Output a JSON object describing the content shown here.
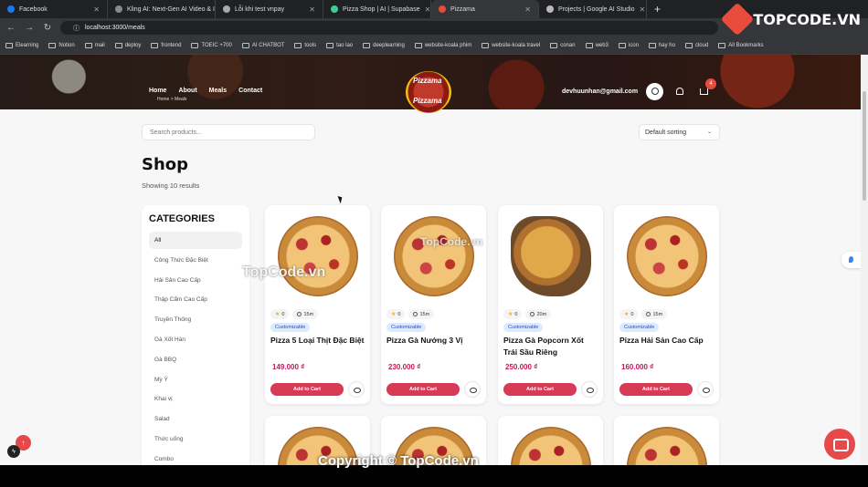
{
  "browser": {
    "tabs": [
      {
        "title": "Facebook",
        "color": "#1877f2"
      },
      {
        "title": "Kling AI: Next-Gen AI Video & I",
        "color": "#888"
      },
      {
        "title": "Lỗi khi test vnpay",
        "color": "#aaa"
      },
      {
        "title": "Pizza Shop | AI | Supabase",
        "color": "#3ecf8e"
      },
      {
        "title": "Pizzama",
        "color": "#e74c3c"
      },
      {
        "title": "Projects | Google AI Studio",
        "color": "#bbb"
      }
    ],
    "url": "localhost:3000/meals",
    "bookmarks": [
      "Elearning",
      "Notion",
      "mail",
      "deploy",
      "frontend",
      "TOEIC +700",
      "AI CHATBOT",
      "tools",
      "tao lao",
      "deeplearning",
      "website-koala phim",
      "website-koala travel",
      "conan",
      "web3",
      "icon",
      "hay ho",
      "cloud"
    ],
    "all_bookmarks": "All Bookmarks",
    "logo_text": "TOPCODE.VN"
  },
  "header": {
    "nav": [
      "Home",
      "About",
      "Meals",
      "Contact"
    ],
    "breadcrumb": "Home  >  Meals",
    "brand": "Pizzama",
    "email": "devhuunhan@gmail.com",
    "cart_count": "4"
  },
  "toolbar": {
    "search_placeholder": "Search products...",
    "sort_label": "Default sorting"
  },
  "shop": {
    "title": "Shop",
    "results": "Showing 10 results"
  },
  "categories": {
    "heading": "CATEGORIES",
    "items": [
      "All",
      "Công Thức Đặc Biệt",
      "Hải Sản Cao Cấp",
      "Thập Cẩm Cao Cấp",
      "Truyền Thống",
      "Gà Xốt Hàn",
      "Gà BBQ",
      "Mỳ Ý",
      "Khai vị",
      "Salad",
      "Thức uống",
      "Combo"
    ]
  },
  "products": [
    {
      "name": "Pizza 5 Loại Thịt Đặc Biệt",
      "price": "149.000 ₫",
      "rating": "0",
      "time": "15m",
      "tag": "Customizable",
      "button": "Add to Cart"
    },
    {
      "name": "Pizza Gà Nướng 3 Vị",
      "price": "230.000 ₫",
      "rating": "0",
      "time": "15m",
      "tag": "Customizable",
      "button": "Add to Cart"
    },
    {
      "name": "Pizza Gà Popcorn Xốt Trái Sầu Riêng",
      "price": "250.000 ₫",
      "rating": "0",
      "time": "20m",
      "tag": "Customizable",
      "button": "Add to Cart"
    },
    {
      "name": "Pizza Hải Sản Cao Cấp",
      "price": "160.000 ₫",
      "rating": "0",
      "time": "15m",
      "tag": "Customizable",
      "button": "Add to Cart"
    }
  ],
  "watermark": {
    "small": "TopCode.vn",
    "center": "TopCode.vn",
    "bottom": "Copyright © TopCode.vn"
  }
}
